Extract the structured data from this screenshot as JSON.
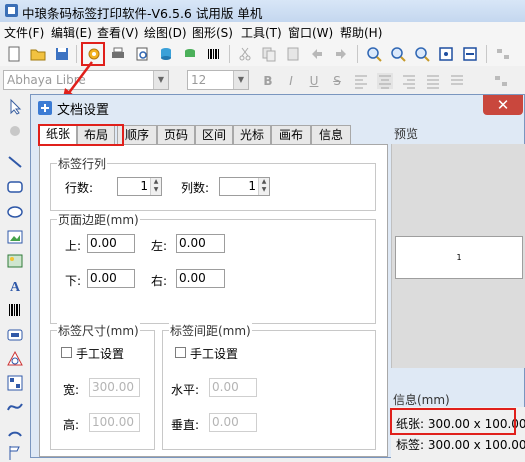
{
  "app": {
    "title": "中琅条码标签打印软件-V6.5.6 试用版 单机"
  },
  "menu": [
    {
      "label": "文件(F)"
    },
    {
      "label": "编辑(E)"
    },
    {
      "label": "查看(V)"
    },
    {
      "label": "绘图(D)"
    },
    {
      "label": "图形(S)"
    },
    {
      "label": "工具(T)"
    },
    {
      "label": "窗口(W)"
    },
    {
      "label": "帮助(H)"
    }
  ],
  "format_bar": {
    "font_name": "Abhaya Libre",
    "font_size": "12",
    "bold": "B",
    "italic": "I",
    "underline": "U",
    "strike": "S"
  },
  "dialog": {
    "title": "文档设置",
    "close": "✕",
    "tabs": [
      {
        "label": "纸张"
      },
      {
        "label": "布局"
      },
      {
        "label": "顺序"
      },
      {
        "label": "页码"
      },
      {
        "label": "区间"
      },
      {
        "label": "光标"
      },
      {
        "label": "画布"
      },
      {
        "label": "信息"
      }
    ],
    "label_rows_cols": {
      "legend": "标签行列",
      "rows_label": "行数:",
      "rows_value": "1",
      "cols_label": "列数:",
      "cols_value": "1"
    },
    "page_margins": {
      "legend": "页面边距(mm)",
      "top_label": "上:",
      "top_value": "0.00",
      "left_label": "左:",
      "left_value": "0.00",
      "bottom_label": "下:",
      "bottom_value": "0.00",
      "right_label": "右:",
      "right_value": "0.00"
    },
    "label_size": {
      "legend": "标签尺寸(mm)",
      "manual_label": "手工设置",
      "width_label": "宽:",
      "width_value": "300.00",
      "height_label": "高:",
      "height_value": "100.00"
    },
    "label_spacing": {
      "legend": "标签间距(mm)",
      "manual_label": "手工设置",
      "horizontal_label": "水平:",
      "horizontal_value": "0.00",
      "vertical_label": "垂直:",
      "vertical_value": "0.00"
    },
    "preview": {
      "title": "预览",
      "page_number": "1"
    },
    "info": {
      "title": "信息(mm)",
      "paper": "纸张: 300.00 x 100.00",
      "label": "标签: 300.00 x 100.00"
    }
  },
  "colors": {
    "highlight": "#e0201b",
    "close_button": "#c9473d",
    "dialog_bg": "#dfe9f5"
  }
}
